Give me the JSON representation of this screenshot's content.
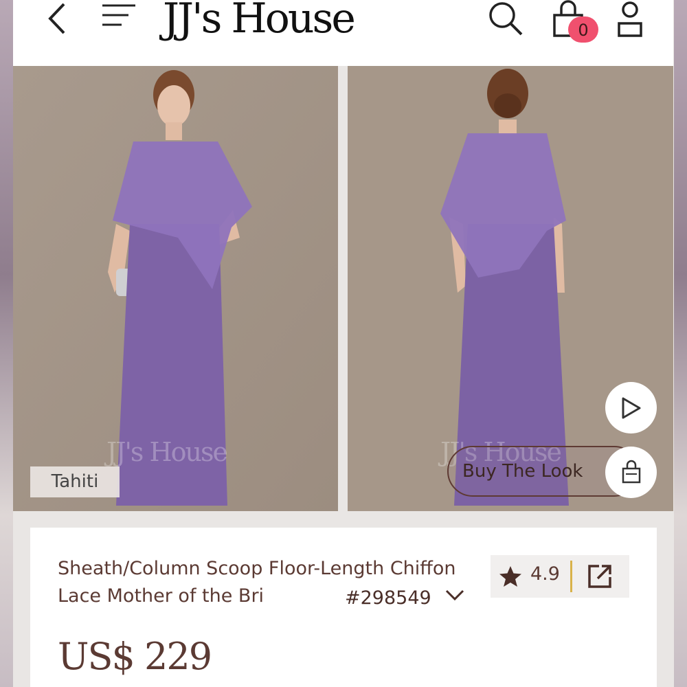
{
  "header": {
    "logo": "JJ's House",
    "cart_count": "0",
    "icons": [
      "back-arrow-icon",
      "menu-icon",
      "search-icon",
      "shopping-bag-icon",
      "user-icon"
    ]
  },
  "gallery": {
    "watermark": "JJ's House",
    "color_tag": "Tahiti",
    "buy_the_look": "Buy The Look",
    "dress_color": "#8a6fb2",
    "background_color": "#a59689"
  },
  "product": {
    "title": "Sheath/Column Scoop Floor-Length Chiffon Lace Mother of the Bri",
    "sku": "#298549",
    "rating": "4.9",
    "price": "US$ 229"
  }
}
